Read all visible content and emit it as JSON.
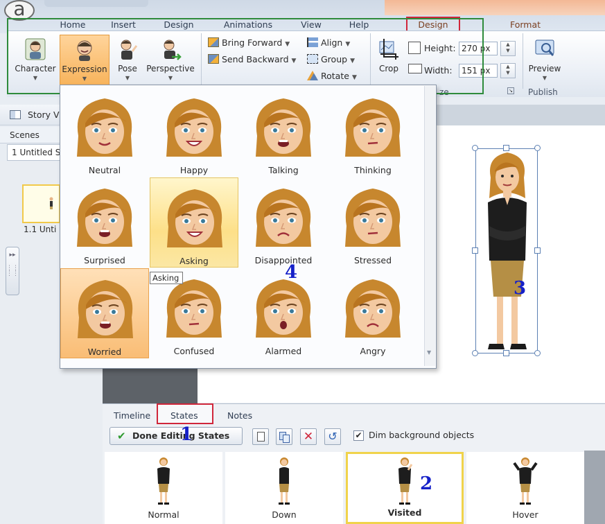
{
  "ribbon_tabs": [
    {
      "label": "Home"
    },
    {
      "label": "Insert"
    },
    {
      "label": "Design"
    },
    {
      "label": "Animations"
    },
    {
      "label": "View"
    },
    {
      "label": "Help"
    },
    {
      "label": "Design"
    },
    {
      "label": "Format"
    }
  ],
  "ribbon": {
    "character": "Character",
    "expression": "Expression",
    "pose": "Pose",
    "perspective": "Perspective",
    "bring_forward": "Bring Forward",
    "send_backward": "Send Backward",
    "align": "Align",
    "group": "Group",
    "rotate": "Rotate",
    "crop": "Crop",
    "height_label": "Height:",
    "height_value": "270 px",
    "width_label": "Width:",
    "width_value": "151 px",
    "size_group": "ze",
    "preview": "Preview",
    "publish": "Publish"
  },
  "left_panel": {
    "story_view": "Story V",
    "scenes_header": "Scenes",
    "scene_item": "1 Untitled S",
    "slide_label": "1.1 Unti"
  },
  "expressions": [
    {
      "label": "Neutral",
      "mouth": "smile"
    },
    {
      "label": "Happy",
      "mouth": "grin"
    },
    {
      "label": "Talking",
      "mouth": "open"
    },
    {
      "label": "Thinking",
      "mouth": "flat"
    },
    {
      "label": "Surprised",
      "mouth": "open"
    },
    {
      "label": "Asking",
      "mouth": "grin"
    },
    {
      "label": "Disappointed",
      "mouth": "frown"
    },
    {
      "label": "Stressed",
      "mouth": "flat"
    },
    {
      "label": "Worried",
      "mouth": "open"
    },
    {
      "label": "Confused",
      "mouth": "flat"
    },
    {
      "label": "Alarmed",
      "mouth": "o"
    },
    {
      "label": "Angry",
      "mouth": "frown"
    }
  ],
  "tooltip": "Asking",
  "bottom_tabs": {
    "timeline": "Timeline",
    "states": "States",
    "notes": "Notes"
  },
  "states_toolbar": {
    "done_button": "Done Editing States",
    "dim_checkbox_label": "Dim background objects",
    "dim_checked": true
  },
  "states": [
    {
      "label": "Normal"
    },
    {
      "label": "Down"
    },
    {
      "label": "Visited"
    },
    {
      "label": "Hover"
    }
  ],
  "annotations": {
    "n1": "1",
    "n2": "2",
    "n3": "3",
    "n4": "4"
  },
  "colors": {
    "highlight_green": "#2e8b3b",
    "highlight_red": "#d0263a",
    "annotation_blue": "#1520c8",
    "expression_button_orange": "#f7b35b",
    "hover_yellow": "#fde089"
  }
}
